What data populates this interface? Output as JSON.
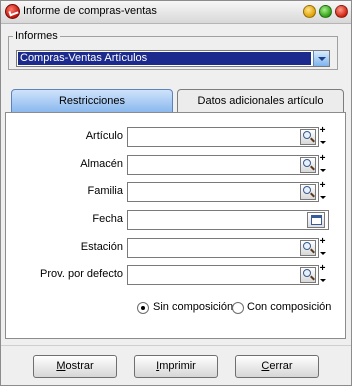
{
  "window": {
    "title": "Informe de compras-ventas"
  },
  "informes": {
    "legend": "Informes",
    "selected": "Compras-Ventas Artículos"
  },
  "tabs": [
    {
      "label": "Restricciones",
      "active": true
    },
    {
      "label": "Datos adicionales artículo",
      "active": false
    }
  ],
  "fields": [
    {
      "label": "Artículo",
      "value": "",
      "type": "lookup"
    },
    {
      "label": "Almacén",
      "value": "",
      "type": "lookup"
    },
    {
      "label": "Familia",
      "value": "",
      "type": "lookup"
    },
    {
      "label": "Fecha",
      "value": "",
      "type": "date"
    },
    {
      "label": "Estación",
      "value": "",
      "type": "lookup"
    },
    {
      "label": "Prov. por defecto",
      "value": "",
      "type": "lookup"
    }
  ],
  "composition": {
    "options": [
      {
        "label": "Sin composición",
        "checked": true
      },
      {
        "label": "Con composición",
        "checked": false
      }
    ]
  },
  "buttons": {
    "mostrar": {
      "accel": "M",
      "rest": "ostrar"
    },
    "imprimir": {
      "accel": "I",
      "rest": "mprimir"
    },
    "cerrar": {
      "accel": "C",
      "rest": "errar"
    }
  },
  "icons": {
    "app": "app-check-icon",
    "lookup": "magnifier-icon",
    "date": "calendar-icon",
    "dropdown": "chevron-down-icon"
  },
  "colors": {
    "selection": "#1b2a8c",
    "tab_active": "#8ab8ee",
    "panel": "#ffffff",
    "window": "#efefef"
  }
}
